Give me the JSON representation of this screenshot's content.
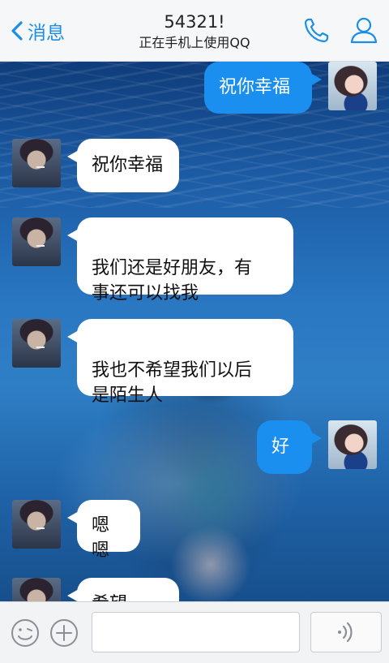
{
  "header": {
    "back_label": "消息",
    "title": "54321!",
    "subtitle": "正在手机上使用QQ",
    "icons": [
      "chevron-left-icon",
      "phone-icon",
      "profile-icon"
    ],
    "accent": "#1a8ee8"
  },
  "messages": [
    {
      "side": "out",
      "text": "祝你幸福"
    },
    {
      "side": "in",
      "text": "祝你幸福"
    },
    {
      "side": "in",
      "text": "我们还是好朋友，有\n事还可以找我"
    },
    {
      "side": "in",
      "text": "我也不希望我们以后\n是陌生人"
    },
    {
      "side": "out",
      "text": "好"
    },
    {
      "side": "in",
      "text": "嗯嗯"
    },
    {
      "side": "in",
      "text": "希望..."
    }
  ],
  "input_bar": {
    "input_value": "",
    "icons": [
      "emoji-icon",
      "plus-icon",
      "voice-icon"
    ]
  },
  "colors": {
    "outgoing_bubble": "#1a8ff0",
    "incoming_bubble": "#ffffff"
  }
}
